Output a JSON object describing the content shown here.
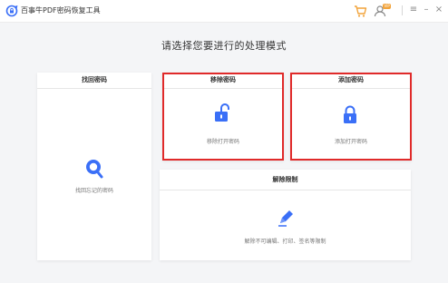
{
  "app": {
    "title": "百事牛PDF密码恢复工具",
    "badge": "VIP"
  },
  "window_controls": {
    "menu": "≡",
    "minimize": "–",
    "close": "×"
  },
  "heading": "请选择您要进行的处理模式",
  "cards": {
    "find": {
      "title": "找回密码",
      "caption": "找回忘记的密码",
      "highlighted": false
    },
    "remove": {
      "title": "移除密码",
      "caption": "移除打开密码",
      "highlighted": true
    },
    "add": {
      "title": "添加密码",
      "caption": "添加打开密码",
      "highlighted": true
    },
    "restrict": {
      "title": "解除限制",
      "caption": "解除不可编辑、打印、签名等限制",
      "highlighted": false
    }
  },
  "colors": {
    "accent": "#3a6ff7",
    "highlight": "#e02a2a",
    "cart": "#f2a33a",
    "vip": "#f2a33a"
  },
  "icons": {
    "logo": "refresh-lock-logo",
    "cart": "cart-icon",
    "user": "user-vip-icon",
    "find": "search-magnifier-icon",
    "remove": "unlock-icon",
    "add": "lock-icon",
    "restrict": "pencil-icon"
  }
}
